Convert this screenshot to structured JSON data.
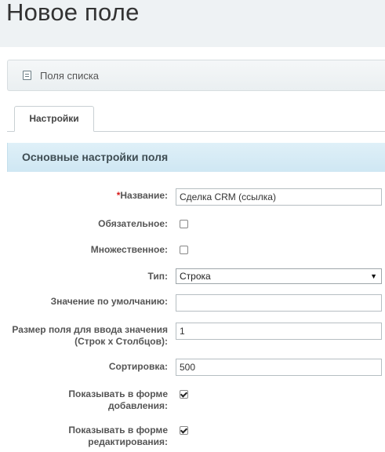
{
  "header": {
    "title": "Новое поле"
  },
  "list_bar": {
    "label": "Поля списка",
    "icon": "list-icon"
  },
  "tabs": [
    {
      "label": "Настройки",
      "active": true
    }
  ],
  "section": {
    "title": "Основные настройки поля"
  },
  "form": {
    "name": {
      "required_mark": "*",
      "label": "Название:",
      "value": "Сделка CRM (ссылка)"
    },
    "required": {
      "label": "Обязательное:",
      "checked": false
    },
    "multiple": {
      "label": "Множественное:",
      "checked": false
    },
    "type": {
      "label": "Тип:",
      "selected": "Строка"
    },
    "default_value": {
      "label": "Значение по умолчанию:",
      "value": ""
    },
    "size": {
      "label_line1": "Размер поля для ввода значения",
      "label_line2": "(Строк х Столбцов):",
      "value": "1"
    },
    "sort": {
      "label": "Сортировка:",
      "value": "500"
    },
    "show_add": {
      "label_line1": "Показывать в форме",
      "label_line2": "добавления:",
      "checked": true
    },
    "show_edit": {
      "label_line1": "Показывать в форме",
      "label_line2": "редактирования:",
      "checked": true
    }
  },
  "colors": {
    "header_bg": "#eef2f4",
    "section_bg": "#d7ebf5",
    "required": "#d61b1b"
  }
}
